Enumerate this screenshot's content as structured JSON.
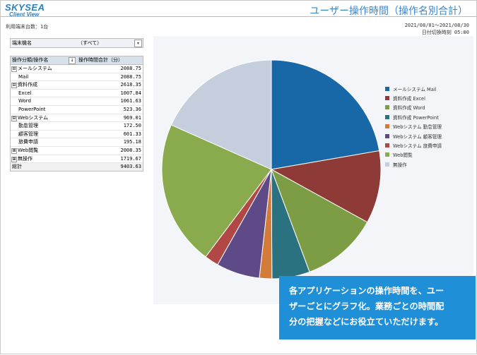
{
  "app": {
    "logo_line1": "SKYSEA",
    "logo_line2": "Client View"
  },
  "title": "ユーザー操作時間（操作名別合計）",
  "meta": {
    "terminals": "利用端末台数：1台",
    "period": "2021/08/01～2021/08/30",
    "cutoff": "日付切換時刻 05:00"
  },
  "filter": {
    "label": "端末機名",
    "value": "（すべて）"
  },
  "table": {
    "headers": {
      "name": "操作分類/操作名",
      "value": "操作時間合計（分）"
    },
    "rows": [
      {
        "name": "メールシステム",
        "value": "2088.75",
        "level": 0,
        "expander": "⊟"
      },
      {
        "name": "Mail",
        "value": "2088.75",
        "level": 1,
        "expander": ""
      },
      {
        "name": "資料作成",
        "value": "2618.35",
        "level": 0,
        "expander": "⊟"
      },
      {
        "name": "Excel",
        "value": "1007.84",
        "level": 1,
        "expander": ""
      },
      {
        "name": "Word",
        "value": "1061.63",
        "level": 1,
        "expander": ""
      },
      {
        "name": "PowerPoint",
        "value": "523.36",
        "level": 1,
        "expander": ""
      },
      {
        "name": "Webシステム",
        "value": "969.01",
        "level": 0,
        "expander": "⊟"
      },
      {
        "name": "勤怠管理",
        "value": "172.50",
        "level": 1,
        "expander": ""
      },
      {
        "name": "顧客管理",
        "value": "601.33",
        "level": 1,
        "expander": ""
      },
      {
        "name": "旅費申請",
        "value": "195.18",
        "level": 1,
        "expander": ""
      },
      {
        "name": "Web閲覧",
        "value": "2008.35",
        "level": 0,
        "expander": "⊞"
      },
      {
        "name": "無操作",
        "value": "1719.67",
        "level": 0,
        "expander": "⊞"
      }
    ],
    "total": {
      "name": "総計",
      "value": "9403.63"
    }
  },
  "chart_data": {
    "type": "pie",
    "slices": [
      {
        "label": "メールシステム Mail",
        "value": 2088.75,
        "color": "#1868a8"
      },
      {
        "label": "資料作成 Excel",
        "value": 1007.84,
        "color": "#8e3a36"
      },
      {
        "label": "資料作成 Word",
        "value": 1061.63,
        "color": "#7d9d44"
      },
      {
        "label": "資料作成 PowerPoint",
        "value": 523.36,
        "color": "#2b7280"
      },
      {
        "label": "Webシステム 勤怠管理",
        "value": 172.5,
        "color": "#d37c3a"
      },
      {
        "label": "Webシステム 顧客管理",
        "value": 601.33,
        "color": "#5e4a86"
      },
      {
        "label": "Webシステム 旅費申請",
        "value": 195.18,
        "color": "#b14845"
      },
      {
        "label": "Web閲覧",
        "value": 2008.35,
        "color": "#8aab4d"
      },
      {
        "label": "無操作",
        "value": 1719.67,
        "color": "#c5cedc"
      }
    ]
  },
  "callout": {
    "lines": [
      "各アプリケーションの操作時間を、ユー",
      "ザーごとにグラフ化。業務ごとの時間配",
      "分の把握などにお役立ていただけます。"
    ]
  }
}
